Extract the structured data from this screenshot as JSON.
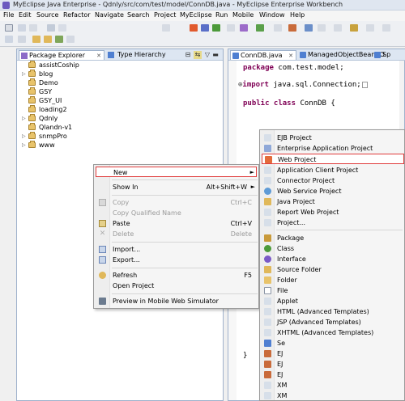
{
  "window": {
    "title": "MyEclipse Java Enterprise - Qdnly/src/com/test/model/ConnDB.java - MyEclipse Enterprise Workbench"
  },
  "menubar": [
    "File",
    "Edit",
    "Source",
    "Refactor",
    "Navigate",
    "Search",
    "Project",
    "MyEclipse",
    "Run",
    "Mobile",
    "Window",
    "Help"
  ],
  "left_panel": {
    "tabs": [
      "Package Explorer",
      "Type Hierarchy"
    ],
    "tree": [
      "assistCoship",
      "blog",
      "Demo",
      "GSY",
      "GSY_UI",
      "loading2",
      "Qdnly",
      "Qlandn-v1",
      "snmpPro",
      "www"
    ]
  },
  "editor": {
    "tabs": [
      "ConnDB.java",
      "ManagedObjectBeanBO.",
      "Sp"
    ],
    "code": {
      "l1_kw": "package",
      "l1_rest": " com.test.model;",
      "l2_kw": "import",
      "l2_rest": " java.sql.Connection;",
      "l3_kw": "public class",
      "l3_rest": " ConnDB {",
      "close": "}"
    }
  },
  "context_menu": {
    "items": [
      {
        "label": "New",
        "shortcut": "",
        "arrow": "►"
      },
      {
        "label": "Show In",
        "shortcut": "Alt+Shift+W",
        "arrow": "►"
      },
      {
        "label": "Copy",
        "shortcut": "Ctrl+C",
        "arrow": ""
      },
      {
        "label": "Copy Qualified Name",
        "shortcut": "",
        "arrow": ""
      },
      {
        "label": "Paste",
        "shortcut": "Ctrl+V",
        "arrow": ""
      },
      {
        "label": "Delete",
        "shortcut": "Delete",
        "arrow": ""
      },
      {
        "label": "Import...",
        "shortcut": "",
        "arrow": ""
      },
      {
        "label": "Export...",
        "shortcut": "",
        "arrow": ""
      },
      {
        "label": "Refresh",
        "shortcut": "F5",
        "arrow": ""
      },
      {
        "label": "Open Project",
        "shortcut": "",
        "arrow": ""
      },
      {
        "label": "Preview in Mobile Web Simulator",
        "shortcut": "",
        "arrow": ""
      }
    ]
  },
  "submenu": {
    "items": [
      "EJB Project",
      "Enterprise Application Project",
      "Web Project",
      "Application Client Project",
      "Connector Project",
      "Web Service Project",
      "Java Project",
      "Report Web Project",
      "Project...",
      "Package",
      "Class",
      "Interface",
      "Source Folder",
      "Folder",
      "File",
      "Applet",
      "HTML (Advanced Templates)",
      "JSP (Advanced Templates)",
      "XHTML (Advanced Templates)",
      "Se",
      "EJ",
      "EJ",
      "EJ",
      "XM",
      "XM"
    ]
  },
  "colors": {
    "highlight_border": "#e03b3b",
    "keyword": "#7f0055",
    "panel_border": "#9fb2cc"
  }
}
